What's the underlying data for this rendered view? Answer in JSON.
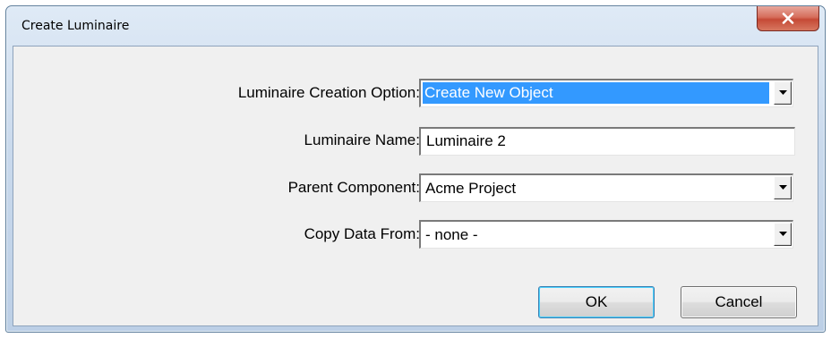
{
  "window": {
    "title": "Create Luminaire"
  },
  "form": {
    "creation_option": {
      "label": "Luminaire Creation Option:",
      "value": "Create New Object"
    },
    "name": {
      "label": "Luminaire Name:",
      "value": "Luminaire 2"
    },
    "parent_component": {
      "label": "Parent Component:",
      "value": "Acme Project"
    },
    "copy_data_from": {
      "label": "Copy Data From:",
      "value": "- none -"
    }
  },
  "buttons": {
    "ok": "OK",
    "cancel": "Cancel"
  },
  "icons": {
    "close": "close-icon",
    "dropdown": "chevron-down-icon"
  },
  "colors": {
    "selection": "#3399ff",
    "close_button": "#c54a36",
    "dialog_face": "#f0f0f0"
  }
}
